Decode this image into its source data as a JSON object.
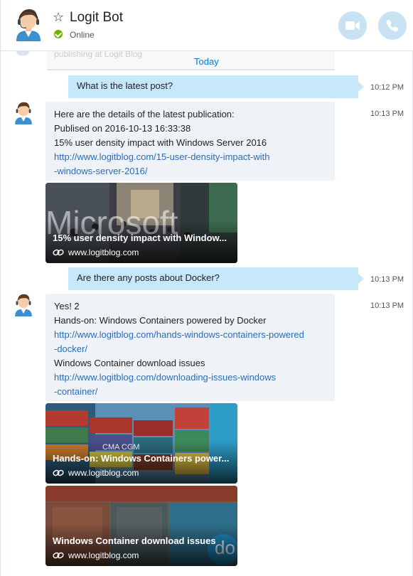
{
  "header": {
    "title": "Logit Bot",
    "status": "Online"
  },
  "conversation": {
    "previous_snippet": "publishing at Logit Blog",
    "date_divider": "Today"
  },
  "messages": [
    {
      "from": "me",
      "text": "What is the latest post?",
      "time": "10:12 PM"
    },
    {
      "from": "bot",
      "time": "10:13 PM",
      "lines": [
        "Here are the details of the latest publication:",
        "Publised on 2016-10-13 16:33:38",
        "15% user density impact with Windows Server 2016"
      ],
      "link_lines": [
        "http://www.logitblog.com/15-user-density-impact-with",
        "-windows-server-2016/"
      ],
      "cards": [
        {
          "title": "15% user density impact with Window...",
          "domain": "www.logitblog.com",
          "image": "microsoft-store"
        }
      ]
    },
    {
      "from": "me",
      "text": "Are there any posts about Docker?",
      "time": "10:13 PM"
    },
    {
      "from": "bot",
      "time": "10:13 PM",
      "lines": [
        "Yes! 2",
        "Hands-on: Windows Containers powered by Docker"
      ],
      "link1_lines": [
        "http://www.logitblog.com/hands-windows-containers-powered",
        "-docker/"
      ],
      "line_mid": "Windows Container download issues",
      "link2_lines": [
        "http://www.logitblog.com/downloading-issues-windows",
        "-container/"
      ],
      "cards": [
        {
          "title": "Hands-on: Windows Containers power...",
          "domain": "www.logitblog.com",
          "image": "shipping-containers"
        },
        {
          "title": "Windows Container download issues",
          "domain": "www.logitblog.com",
          "image": "docker-containers"
        }
      ]
    }
  ],
  "colors": {
    "my_bubble": "#c7e7fa",
    "bot_bubble": "#eff2f7",
    "link": "#2a6db5",
    "accent": "#0078d4",
    "online": "#6bb700",
    "header_button": "#c8e2f4"
  }
}
